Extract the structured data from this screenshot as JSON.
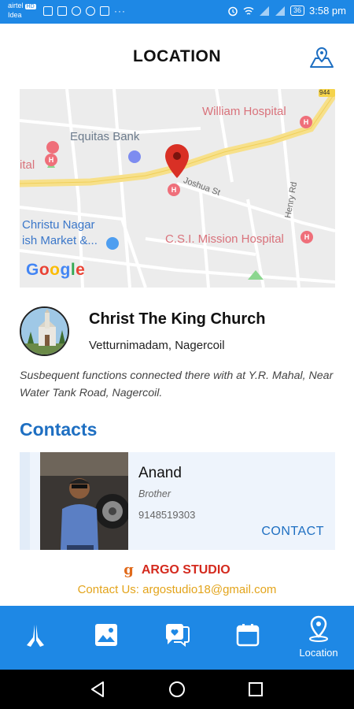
{
  "status_bar": {
    "carrier_line1": "airtel",
    "carrier_badge": "HD",
    "carrier_line2": "Idea",
    "more": "···",
    "battery": "36",
    "time": "3:58 pm"
  },
  "header": {
    "title": "LOCATION",
    "map_icon": "map-pin-icon"
  },
  "map": {
    "labels": {
      "william_hospital": "William Hospital",
      "equitas_bank": "Equitas Bank",
      "ital": "ital",
      "joshua_st": "Joshua St",
      "henry_rd": "Henry Rd",
      "christu_nagar": "Christu Nagar",
      "fish_market": "ish Market &...",
      "csi_hospital": "C.S.I. Mission Hospital",
      "road_number": "944"
    },
    "google_logo": "Google",
    "colors": {
      "road": "#f7e08a",
      "bg": "#ececec",
      "pin": "#d93025",
      "poi": "#ef6f7a",
      "bank": "#7d8cf0",
      "shop": "#4e9ef0",
      "park": "#8bd68f"
    }
  },
  "church": {
    "name": "Christ The King Church",
    "location": "Vetturnimadam, Nagercoil",
    "description": "Susbequent functions connected there with at Y.R. Mahal, Near Water Tank Road, Nagercoil."
  },
  "contacts": {
    "title": "Contacts",
    "items": [
      {
        "name": "Anand",
        "relation": "Brother",
        "phone": "9148519303",
        "button": "CONTACT"
      }
    ]
  },
  "footer": {
    "logo_glyph": "g",
    "studio": "ARGO STUDIO",
    "contact": "Contact Us: argostudio18@gmail.com"
  },
  "bottom_nav": {
    "items": [
      {
        "icon": "praying-hands-icon",
        "label": ""
      },
      {
        "icon": "gallery-icon",
        "label": ""
      },
      {
        "icon": "chat-heart-icon",
        "label": ""
      },
      {
        "icon": "calendar-icon",
        "label": ""
      },
      {
        "icon": "location-pin-icon",
        "label": "Location"
      }
    ],
    "active_index": 4,
    "color": "#1e88e5"
  },
  "system_nav": {
    "icons": [
      "back-icon",
      "home-icon",
      "recents-icon"
    ]
  },
  "colors": {
    "accent": "#1e88e5",
    "heading_blue": "#1e6fc2",
    "credit_red": "#d42a1e",
    "credit_gold": "#e3a41b"
  }
}
